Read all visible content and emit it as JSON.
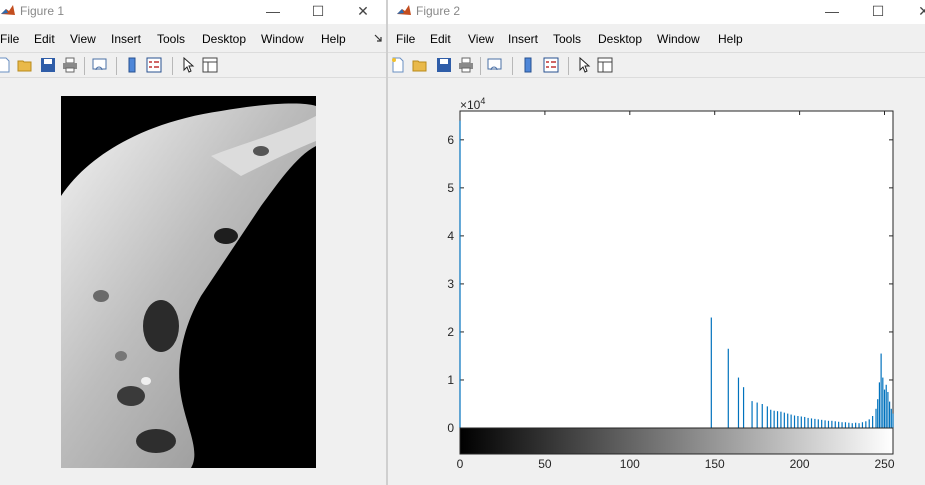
{
  "windows": [
    {
      "title": "Figure 1",
      "menu": [
        "File",
        "Edit",
        "View",
        "Insert",
        "Tools",
        "Desktop",
        "Window",
        "Help"
      ],
      "overflow_icon": "dock-arrow-icon",
      "controls": [
        "—",
        "☐",
        "✕"
      ]
    },
    {
      "title": "Figure 2",
      "menu": [
        "File",
        "Edit",
        "View",
        "Insert",
        "Tools",
        "Desktop",
        "Window",
        "Help"
      ],
      "controls": [
        "—",
        "☐",
        "✕"
      ]
    }
  ],
  "toolbar_icons": [
    "new-figure-icon",
    "open-file-icon",
    "save-icon",
    "print-icon",
    "link-plot-icon",
    "insert-colorbar-icon",
    "insert-legend-icon",
    "edit-plot-arrow-icon",
    "property-inspector-icon"
  ],
  "chart_data": {
    "type": "bar",
    "exponent_label": "×10",
    "exponent_power": "4",
    "x_ticks": [
      0,
      50,
      100,
      150,
      200,
      250
    ],
    "y_ticks": [
      0,
      1,
      2,
      3,
      4,
      5,
      6
    ],
    "xlim": [
      0,
      255
    ],
    "ylim": [
      0,
      66000
    ],
    "bar_color": "#0072bd",
    "colorbar": "gray",
    "bars": {
      "x": [
        0,
        148,
        158,
        164,
        167,
        172,
        175,
        178,
        181,
        183,
        185,
        187,
        189,
        191,
        193,
        195,
        197,
        199,
        201,
        203,
        205,
        207,
        209,
        211,
        213,
        215,
        217,
        219,
        221,
        223,
        225,
        227,
        229,
        231,
        233,
        235,
        237,
        239,
        241,
        243,
        245,
        246,
        247,
        248,
        249,
        250,
        251,
        252,
        253,
        254,
        255
      ],
      "y": [
        64000,
        23000,
        16500,
        10500,
        8500,
        5600,
        5300,
        5000,
        4500,
        3800,
        3600,
        3500,
        3400,
        3200,
        3000,
        2800,
        2600,
        2500,
        2400,
        2300,
        2100,
        2000,
        1900,
        1800,
        1700,
        1600,
        1500,
        1500,
        1400,
        1300,
        1200,
        1200,
        1100,
        1000,
        1100,
        1000,
        1200,
        1400,
        1800,
        2500,
        4000,
        6000,
        9500,
        15500,
        10500,
        8000,
        9000,
        7500,
        5500,
        4000,
        3000
      ]
    }
  }
}
